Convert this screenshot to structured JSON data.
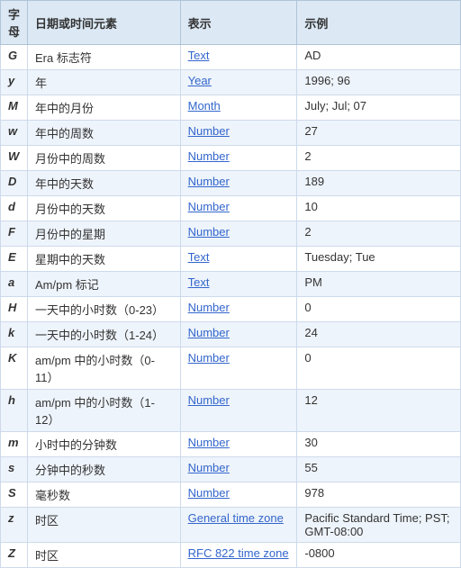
{
  "table": {
    "headers": [
      "字母",
      "日期或时间元素",
      "表示",
      "示例"
    ],
    "rows": [
      {
        "char": "G",
        "desc": "Era 标志符",
        "type_label": "Text",
        "type_link": true,
        "example": "AD"
      },
      {
        "char": "y",
        "desc": "年",
        "type_label": "Year",
        "type_link": true,
        "example": "1996; 96"
      },
      {
        "char": "M",
        "desc": "年中的月份",
        "type_label": "Month",
        "type_link": true,
        "example": "July; Jul; 07"
      },
      {
        "char": "w",
        "desc": "年中的周数",
        "type_label": "Number",
        "type_link": true,
        "example": "27"
      },
      {
        "char": "W",
        "desc": "月份中的周数",
        "type_label": "Number",
        "type_link": true,
        "example": "2"
      },
      {
        "char": "D",
        "desc": "年中的天数",
        "type_label": "Number",
        "type_link": true,
        "example": "189"
      },
      {
        "char": "d",
        "desc": "月份中的天数",
        "type_label": "Number",
        "type_link": true,
        "example": "10"
      },
      {
        "char": "F",
        "desc": "月份中的星期",
        "type_label": "Number",
        "type_link": true,
        "example": "2"
      },
      {
        "char": "E",
        "desc": "星期中的天数",
        "type_label": "Text",
        "type_link": true,
        "example": "Tuesday; Tue"
      },
      {
        "char": "a",
        "desc": "Am/pm 标记",
        "type_label": "Text",
        "type_link": true,
        "example": "PM"
      },
      {
        "char": "H",
        "desc": "一天中的小时数（0-23）",
        "type_label": "Number",
        "type_link": true,
        "example": "0"
      },
      {
        "char": "k",
        "desc": "一天中的小时数（1-24）",
        "type_label": "Number",
        "type_link": true,
        "example": "24"
      },
      {
        "char": "K",
        "desc": "am/pm 中的小时数（0-11）",
        "type_label": "Number",
        "type_link": true,
        "example": "0"
      },
      {
        "char": "h",
        "desc": "am/pm 中的小时数（1-12）",
        "type_label": "Number",
        "type_link": true,
        "example": "12"
      },
      {
        "char": "m",
        "desc": "小时中的分钟数",
        "type_label": "Number",
        "type_link": true,
        "example": "30"
      },
      {
        "char": "s",
        "desc": "分钟中的秒数",
        "type_label": "Number",
        "type_link": true,
        "example": "55"
      },
      {
        "char": "S",
        "desc": "毫秒数",
        "type_label": "Number",
        "type_link": true,
        "example": "978"
      },
      {
        "char": "z",
        "desc": "时区",
        "type_label": "General time zone",
        "type_link": true,
        "example": "Pacific Standard Time; PST; GMT-08:00"
      },
      {
        "char": "Z",
        "desc": "时区",
        "type_label": "RFC 822 time zone",
        "type_link": true,
        "example": "-0800"
      }
    ]
  }
}
